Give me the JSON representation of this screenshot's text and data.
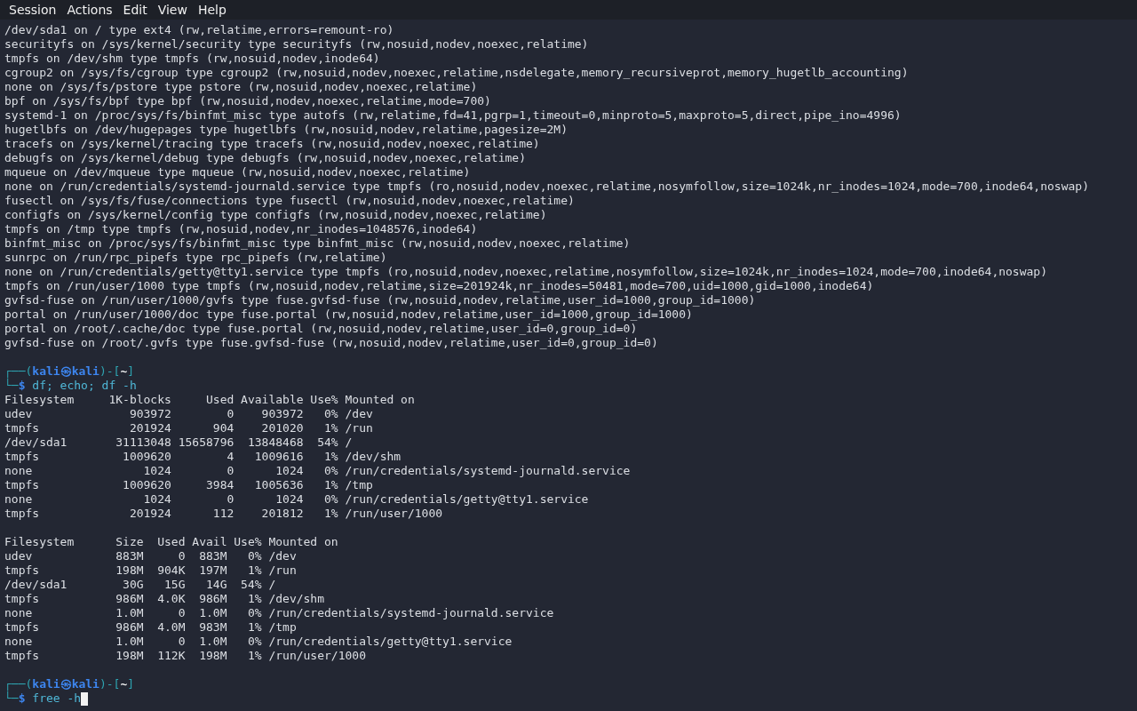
{
  "menu": [
    "Session",
    "Actions",
    "Edit",
    "View",
    "Help"
  ],
  "terminal": {
    "blocks": [
      {
        "kind": "output",
        "lines": [
          "/dev/sda1 on / type ext4 (rw,relatime,errors=remount-ro)",
          "securityfs on /sys/kernel/security type securityfs (rw,nosuid,nodev,noexec,relatime)",
          "tmpfs on /dev/shm type tmpfs (rw,nosuid,nodev,inode64)",
          "cgroup2 on /sys/fs/cgroup type cgroup2 (rw,nosuid,nodev,noexec,relatime,nsdelegate,memory_recursiveprot,memory_hugetlb_accounting)",
          "none on /sys/fs/pstore type pstore (rw,nosuid,nodev,noexec,relatime)",
          "bpf on /sys/fs/bpf type bpf (rw,nosuid,nodev,noexec,relatime,mode=700)",
          "systemd-1 on /proc/sys/fs/binfmt_misc type autofs (rw,relatime,fd=41,pgrp=1,timeout=0,minproto=5,maxproto=5,direct,pipe_ino=4996)",
          "hugetlbfs on /dev/hugepages type hugetlbfs (rw,nosuid,nodev,relatime,pagesize=2M)",
          "tracefs on /sys/kernel/tracing type tracefs (rw,nosuid,nodev,noexec,relatime)",
          "debugfs on /sys/kernel/debug type debugfs (rw,nosuid,nodev,noexec,relatime)",
          "mqueue on /dev/mqueue type mqueue (rw,nosuid,nodev,noexec,relatime)",
          "none on /run/credentials/systemd-journald.service type tmpfs (ro,nosuid,nodev,noexec,relatime,nosymfollow,size=1024k,nr_inodes=1024,mode=700,inode64,noswap)",
          "fusectl on /sys/fs/fuse/connections type fusectl (rw,nosuid,nodev,noexec,relatime)",
          "configfs on /sys/kernel/config type configfs (rw,nosuid,nodev,noexec,relatime)",
          "tmpfs on /tmp type tmpfs (rw,nosuid,nodev,nr_inodes=1048576,inode64)",
          "binfmt_misc on /proc/sys/fs/binfmt_misc type binfmt_misc (rw,nosuid,nodev,noexec,relatime)",
          "sunrpc on /run/rpc_pipefs type rpc_pipefs (rw,relatime)",
          "none on /run/credentials/getty@tty1.service type tmpfs (ro,nosuid,nodev,noexec,relatime,nosymfollow,size=1024k,nr_inodes=1024,mode=700,inode64,noswap)",
          "tmpfs on /run/user/1000 type tmpfs (rw,nosuid,nodev,relatime,size=201924k,nr_inodes=50481,mode=700,uid=1000,gid=1000,inode64)",
          "gvfsd-fuse on /run/user/1000/gvfs type fuse.gvfsd-fuse (rw,nosuid,nodev,relatime,user_id=1000,group_id=1000)",
          "portal on /run/user/1000/doc type fuse.portal (rw,nosuid,nodev,relatime,user_id=1000,group_id=1000)",
          "portal on /root/.cache/doc type fuse.portal (rw,nosuid,nodev,relatime,user_id=0,group_id=0)",
          "gvfsd-fuse on /root/.gvfs type fuse.gvfsd-fuse (rw,nosuid,nodev,relatime,user_id=0,group_id=0)"
        ]
      },
      {
        "kind": "blank"
      },
      {
        "kind": "prompt",
        "open": "┌──(",
        "user": "kali",
        "separator": "㉿",
        "host": "kali",
        "mid": ")-[",
        "dir": "~",
        "close": "]",
        "lead": "└─",
        "symbol": "$",
        "command": "df; echo; df -h",
        "cursor": false
      },
      {
        "kind": "output",
        "lines": [
          "Filesystem     1K-blocks     Used Available Use% Mounted on",
          "udev              903972        0    903972   0% /dev",
          "tmpfs             201924      904    201020   1% /run",
          "/dev/sda1       31113048 15658796  13848468  54% /",
          "tmpfs            1009620        4   1009616   1% /dev/shm",
          "none                1024        0      1024   0% /run/credentials/systemd-journald.service",
          "tmpfs            1009620     3984   1005636   1% /tmp",
          "none                1024        0      1024   0% /run/credentials/getty@tty1.service",
          "tmpfs             201924      112    201812   1% /run/user/1000"
        ]
      },
      {
        "kind": "blank"
      },
      {
        "kind": "output",
        "lines": [
          "Filesystem      Size  Used Avail Use% Mounted on",
          "udev            883M     0  883M   0% /dev",
          "tmpfs           198M  904K  197M   1% /run",
          "/dev/sda1        30G   15G   14G  54% /",
          "tmpfs           986M  4.0K  986M   1% /dev/shm",
          "none            1.0M     0  1.0M   0% /run/credentials/systemd-journald.service",
          "tmpfs           986M  4.0M  983M   1% /tmp",
          "none            1.0M     0  1.0M   0% /run/credentials/getty@tty1.service",
          "tmpfs           198M  112K  198M   1% /run/user/1000"
        ]
      },
      {
        "kind": "blank"
      },
      {
        "kind": "prompt",
        "open": "┌──(",
        "user": "kali",
        "separator": "㉿",
        "host": "kali",
        "mid": ")-[",
        "dir": "~",
        "close": "]",
        "lead": "└─",
        "symbol": "$",
        "command": "free -h",
        "cursor": true
      }
    ]
  }
}
